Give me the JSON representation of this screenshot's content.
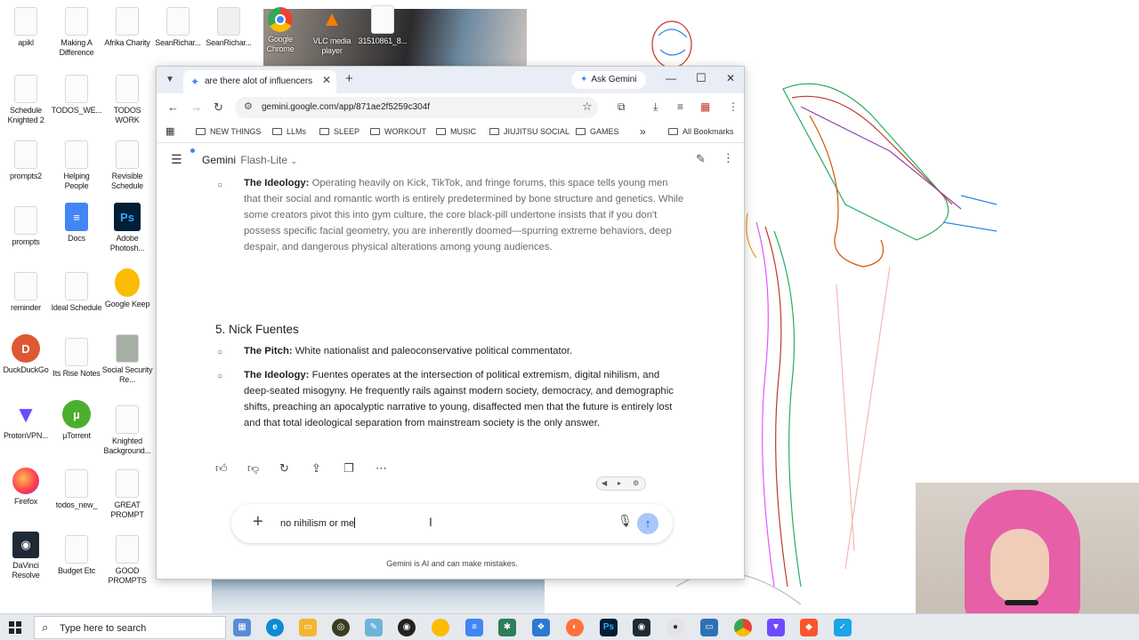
{
  "desktop": {
    "icons": [
      {
        "label": "apikl"
      },
      {
        "label": "Making A Difference"
      },
      {
        "label": "Afrika Charity"
      },
      {
        "label": "SeanRichar..."
      },
      {
        "label": "SeanRichar..."
      },
      {
        "label": "Google Chrome"
      },
      {
        "label": "VLC media player"
      },
      {
        "label": "31510861_8..."
      },
      {
        "label": "Schedule Knighted 2"
      },
      {
        "label": "TODOS_WE..."
      },
      {
        "label": "TODOS WORK"
      },
      {
        "label": "prompts2"
      },
      {
        "label": "Helping People"
      },
      {
        "label": "Revisible Schedule"
      },
      {
        "label": "prompts"
      },
      {
        "label": "Docs"
      },
      {
        "label": "Adobe Photosh..."
      },
      {
        "label": "reminder"
      },
      {
        "label": "Ideal Schedule"
      },
      {
        "label": "Google Keep"
      },
      {
        "label": "DuckDuckGo"
      },
      {
        "label": "Its Rise Notes"
      },
      {
        "label": "Social Security Re..."
      },
      {
        "label": "ProtonVPN..."
      },
      {
        "label": "µTorrent"
      },
      {
        "label": "Knighted Background..."
      },
      {
        "label": "Firefox"
      },
      {
        "label": "todos_new_"
      },
      {
        "label": "GREAT PROMPT"
      },
      {
        "label": "DaVinci Resolve"
      },
      {
        "label": "Budget Etc"
      },
      {
        "label": "GOOD PROMPTS"
      }
    ]
  },
  "browser": {
    "tab_title": "are there alot of influencers on",
    "ask_gemini": "Ask Gemini",
    "url": "gemini.google.com/app/871ae2f5259c304f",
    "bookmarks": [
      "NEW THINGS",
      "LLMs",
      "SLEEP",
      "WORKOUT",
      "MUSIC",
      "JIUJITSU SOCIAL",
      "GAMES"
    ],
    "bookmarks_overflow": "»",
    "all_bookmarks": "All Bookmarks"
  },
  "gemini": {
    "brand": "Gemini",
    "model": "Flash-Lite",
    "item4": {
      "label": "The Ideology:",
      "text": " Operating heavily on Kick, TikTok, and fringe forums, this space tells young men that their social and romantic worth is entirely predetermined by bone structure and genetics. While some creators pivot this into gym culture, the core black-pill undertone insists that if you don't possess specific facial geometry, you are inherently doomed—spurring extreme behaviors, deep despair, and dangerous physical alterations among young audiences."
    },
    "heading5": "5. Nick Fuentes",
    "pitch": {
      "label": "The Pitch:",
      "text": " White nationalist and paleoconservative political commentator."
    },
    "ideology5": {
      "label": "The Ideology:",
      "text": " Fuentes operates at the intersection of political extremism, digital nihilism, and deep-seated misogyny. He frequently rails against modern society, democracy, and demographic shifts, preaching an apocalyptic narrative to young, disaffected men that the future is entirely lost and that total ideological separation from mainstream society is the only answer."
    },
    "input_value": "no nihilism or me",
    "disclaimer": "Gemini is AI and can make mistakes."
  },
  "taskbar": {
    "search_placeholder": "Type here to search"
  },
  "colors": {
    "accent": "#4285f4",
    "send_bg": "#a8c7fa",
    "tabbar_bg": "#e9eef6"
  }
}
